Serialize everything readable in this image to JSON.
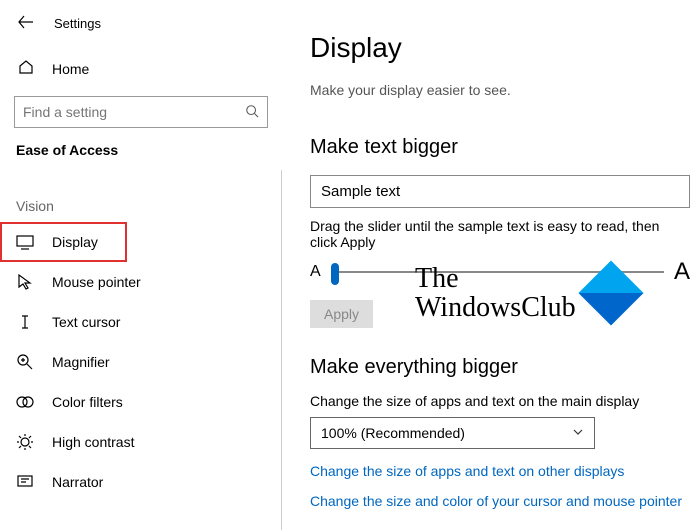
{
  "app": {
    "title": "Settings"
  },
  "sidebar": {
    "home": "Home",
    "search_placeholder": "Find a setting",
    "section": "Ease of Access",
    "group": "Vision",
    "items": [
      {
        "label": "Display"
      },
      {
        "label": "Mouse pointer"
      },
      {
        "label": "Text cursor"
      },
      {
        "label": "Magnifier"
      },
      {
        "label": "Color filters"
      },
      {
        "label": "High contrast"
      },
      {
        "label": "Narrator"
      }
    ]
  },
  "main": {
    "title": "Display",
    "subtitle": "Make your display easier to see.",
    "text_bigger": {
      "heading": "Make text bigger",
      "sample": "Sample text",
      "instruction": "Drag the slider until the sample text is easy to read, then click Apply",
      "small_a": "A",
      "large_a": "A",
      "apply": "Apply"
    },
    "everything_bigger": {
      "heading": "Make everything bigger",
      "desc": "Change the size of apps and text on the main display",
      "value": "100% (Recommended)",
      "link1": "Change the size of apps and text on other displays",
      "link2": "Change the size and color of your cursor and mouse pointer"
    }
  },
  "watermark": {
    "line1": "The",
    "line2": "WindowsClub"
  }
}
